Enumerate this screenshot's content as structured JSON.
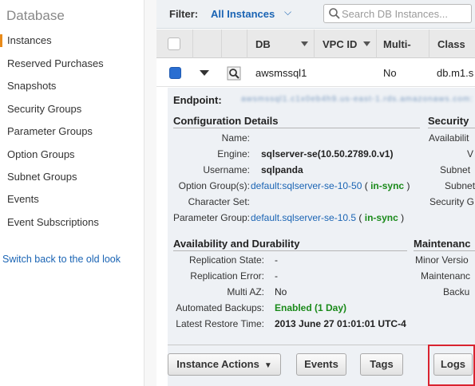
{
  "sidebar": {
    "heading": "Database",
    "items": [
      {
        "label": "Instances",
        "active": true
      },
      {
        "label": "Reserved Purchases"
      },
      {
        "label": "Snapshots"
      },
      {
        "label": "Security Groups"
      },
      {
        "label": "Parameter Groups"
      },
      {
        "label": "Option Groups"
      },
      {
        "label": "Subnet Groups"
      },
      {
        "label": "Events"
      },
      {
        "label": "Event Subscriptions"
      }
    ],
    "switch_link": "Switch back to the old look"
  },
  "filter": {
    "label": "Filter:",
    "value": "All Instances",
    "search_placeholder": "Search DB Instances..."
  },
  "table": {
    "columns": [
      "DB",
      "VPC ID",
      "Multi-",
      "Class"
    ],
    "row": {
      "db": "awsmssql1",
      "vpc_id": "",
      "multi_az": "No",
      "class": "db.m1.s"
    }
  },
  "details": {
    "endpoint_label": "Endpoint:",
    "endpoint_value": "awsmssql1.c1x0eb4h9.us-east-1.rds.amazonaws.com:1433",
    "config": {
      "title": "Configuration Details",
      "name_label": "Name:",
      "name_value": "",
      "engine_label": "Engine:",
      "engine_value": "sqlserver-se(10.50.2789.0.v1)",
      "username_label": "Username:",
      "username_value": "sqlpanda",
      "option_groups_label": "Option Group(s):",
      "option_groups_link": "default:sqlserver-se-10-50",
      "option_groups_open": "(",
      "option_groups_status": "in-sync",
      "option_groups_close": ")",
      "charset_label": "Character Set:",
      "charset_value": "",
      "param_group_label": "Parameter Group:",
      "param_group_link": "default.sqlserver-se-10.5",
      "param_group_open": "(",
      "param_group_status": "in-sync",
      "param_group_close": ")"
    },
    "security": {
      "title": "Security",
      "labels": [
        "Availabilit",
        "V",
        "Subnet",
        "Subnets",
        "Security G"
      ]
    },
    "availability": {
      "title": "Availability and Durability",
      "replication_state_label": "Replication State:",
      "replication_state_value": "-",
      "replication_error_label": "Replication Error:",
      "replication_error_value": "-",
      "multi_az_label": "Multi AZ:",
      "multi_az_value": "No",
      "auto_backups_label": "Automated Backups:",
      "auto_backups_value": "Enabled (1 Day)",
      "latest_restore_label": "Latest Restore Time:",
      "latest_restore_value": "2013 June 27 01:01:01 UTC-4"
    },
    "maintenance": {
      "title": "Maintenanc",
      "labels": [
        "Minor Versio",
        "Maintenanc",
        "Backu"
      ]
    }
  },
  "actions": {
    "instance_actions": "Instance Actions",
    "events": "Events",
    "tags": "Tags",
    "logs": "Logs"
  },
  "colors": {
    "accent_link": "#1a64b4",
    "status_green": "#1a8a1a",
    "highlight_red": "#d9232f",
    "selected_checkbox": "#2a6ed1"
  }
}
